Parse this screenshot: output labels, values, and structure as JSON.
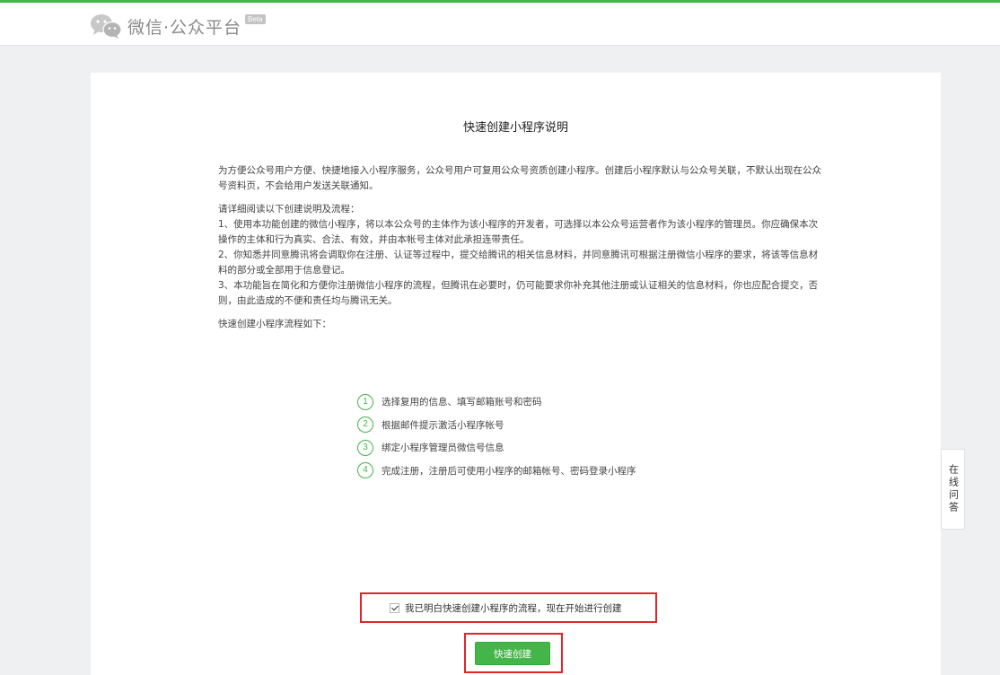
{
  "header": {
    "logo_text": "微信·公众平台",
    "beta_badge": "Beta"
  },
  "page": {
    "title": "快速创建小程序说明",
    "intro": "为方便公众号用户方便、快捷地接入小程序服务，公众号用户可复用公众号资质创建小程序。创建后小程序默认与公众号关联，不默认出现在公众号资料页，不会给用户发送关联通知。",
    "read_heading": "请详细阅读以下创建说明及流程：",
    "clauses": [
      "1、使用本功能创建的微信小程序，将以本公众号的主体作为该小程序的开发者，可选择以本公众号运营者作为该小程序的管理员。你应确保本次操作的主体和行为真实、合法、有效，并由本帐号主体对此承担连带责任。",
      "2、你知悉并同意腾讯将会调取你在注册、认证等过程中，提交给腾讯的相关信息材料，并同意腾讯可根据注册微信小程序的要求，将该等信息材料的部分或全部用于信息登记。",
      "3、本功能旨在简化和方便你注册微信小程序的流程，但腾讯在必要时，仍可能要求你补充其他注册或认证相关的信息材料，你也应配合提交，否则，由此造成的不便和责任均与腾讯无关。"
    ],
    "flow_heading": "快速创建小程序流程如下："
  },
  "steps": [
    {
      "num": "1",
      "text": "选择复用的信息、填写邮箱账号和密码"
    },
    {
      "num": "2",
      "text": "根据邮件提示激活小程序帐号"
    },
    {
      "num": "3",
      "text": "绑定小程序管理员微信号信息"
    },
    {
      "num": "4",
      "text": "完成注册，注册后可使用小程序的邮箱帐号、密码登录小程序"
    }
  ],
  "agreement": {
    "checked": true,
    "label": "我已明白快速创建小程序的流程，现在开始进行创建"
  },
  "create_button": {
    "label": "快速创建"
  },
  "side_help": {
    "label": "在线问答"
  },
  "colors": {
    "brand_green": "#44b549",
    "highlight_red": "#e0262b"
  }
}
